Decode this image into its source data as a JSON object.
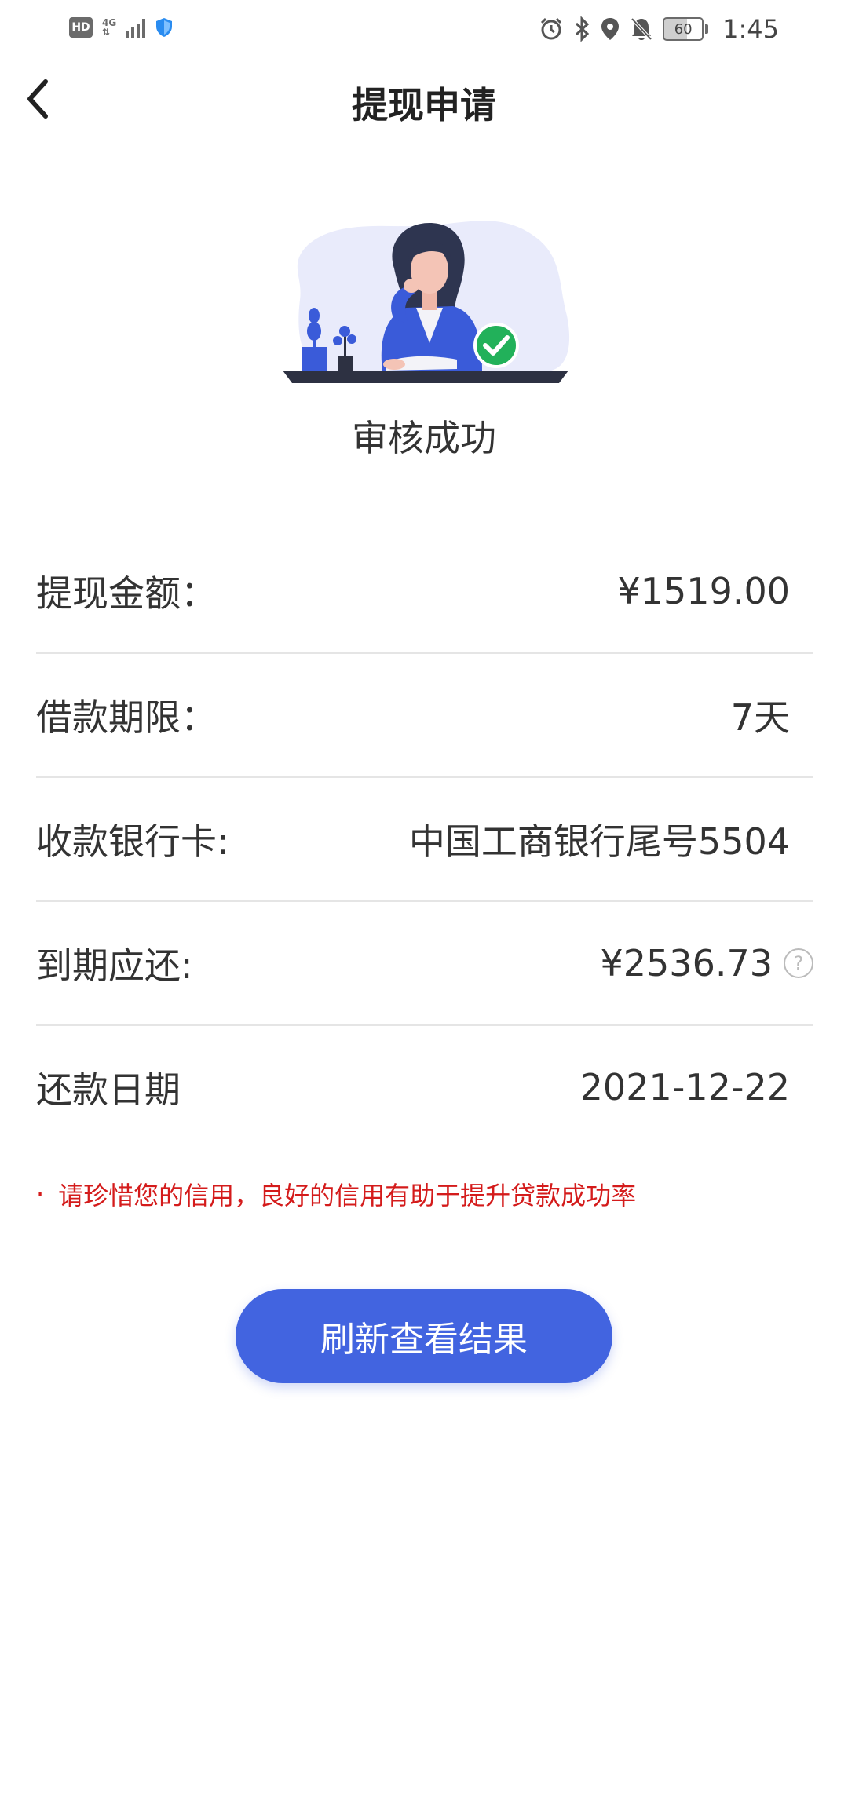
{
  "status_bar": {
    "hd_label": "HD",
    "network_label": "4G",
    "battery_level": "60",
    "time": "1:45",
    "icons": [
      "shield-icon",
      "alarm-icon",
      "bluetooth-icon",
      "location-icon",
      "bell-off-icon"
    ]
  },
  "header": {
    "title": "提现申请",
    "back_icon": "chevron-left-icon"
  },
  "result": {
    "status": "审核成功",
    "illustration": "woman-at-desk-with-check-illustration"
  },
  "details": [
    {
      "label": "提现金额：",
      "value": "¥1519.00"
    },
    {
      "label": "借款期限：",
      "value": "7天"
    },
    {
      "label": "收款银行卡:",
      "value": "中国工商银行尾号5504"
    },
    {
      "label": "到期应还:",
      "value": "¥2536.73",
      "help_icon": "?"
    },
    {
      "label": "还款日期",
      "value": "2021-12-22"
    }
  ],
  "notice": {
    "bullet": "·",
    "text": "请珍惜您的信用，良好的信用有助于提升贷款成功率"
  },
  "actions": {
    "refresh_label": "刷新查看结果"
  },
  "colors": {
    "primary": "#4264e0",
    "notice": "#d41b1b",
    "success": "#22b15a",
    "divider": "#e5e5e5"
  }
}
